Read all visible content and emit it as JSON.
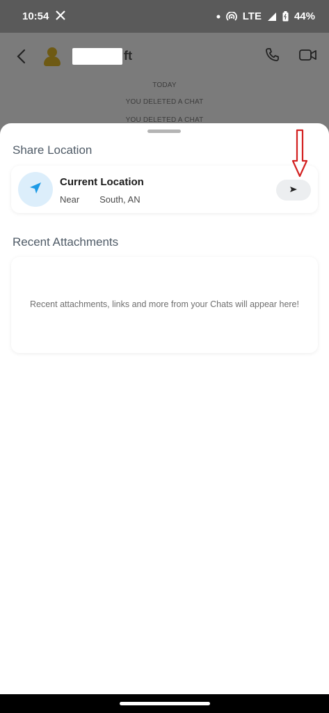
{
  "status_bar": {
    "time": "10:54",
    "network": "LTE",
    "battery": "44%"
  },
  "chat_header": {
    "contact_name_visible": "ft"
  },
  "chat_messages": [
    "TODAY",
    "YOU DELETED A CHAT",
    "YOU DELETED A CHAT"
  ],
  "share_location": {
    "title": "Share Location",
    "current_location_title": "Current Location",
    "current_location_subtitle": "Near        South, AN"
  },
  "recent_attachments": {
    "title": "Recent Attachments",
    "empty_text": "Recent attachments, links and more from your Chats will appear here!"
  },
  "colors": {
    "status_bg": "#5a5a5a",
    "dim_overlay": "#7b7b7b",
    "location_icon_bg": "#dceefb",
    "location_icon": "#1e9be6",
    "annotation_arrow": "#d32020"
  }
}
